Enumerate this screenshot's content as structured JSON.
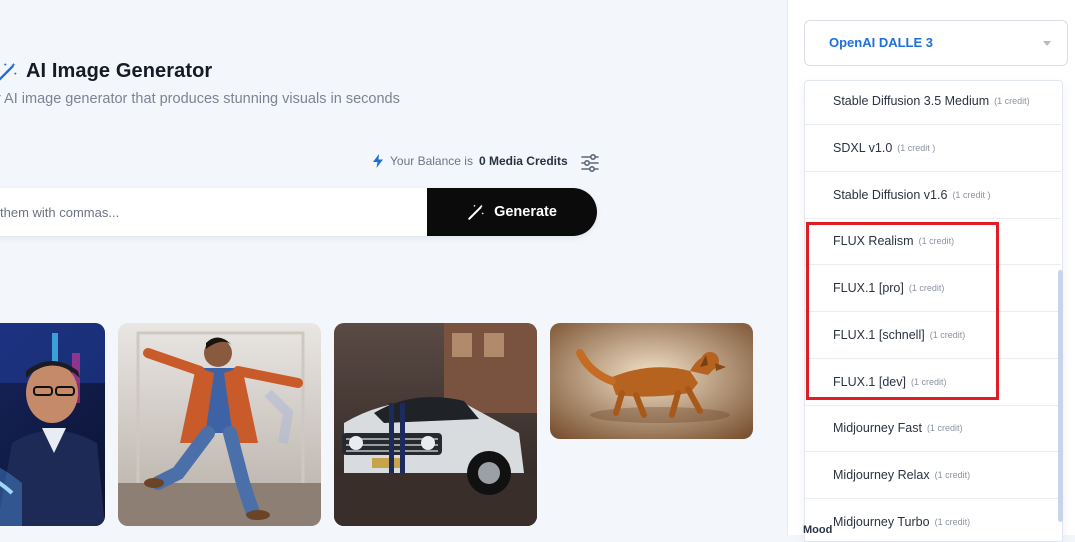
{
  "header": {
    "title": "AI Image Generator",
    "subtitle": "r AI image generator that produces stunning visuals in seconds"
  },
  "balance": {
    "prefix": "Your Balance is",
    "amount": "0 Media Credits"
  },
  "prompt": {
    "placeholder": "them with commas...",
    "value": "",
    "generate_label": "Generate"
  },
  "gallery": [
    {
      "subject": "man in suit driving car at night"
    },
    {
      "subject": "dancer in colorful jacket"
    },
    {
      "subject": "vintage white muscle car"
    },
    {
      "subject": "golden retriever walking"
    }
  ],
  "sidebar": {
    "model_selected": "OpenAI DALLE 3",
    "options": [
      {
        "name": "Stable Diffusion 3.5 Medium",
        "credit": "(1 credit)"
      },
      {
        "name": "SDXL v1.0",
        "credit": "(1 credit )"
      },
      {
        "name": "Stable Diffusion v1.6",
        "credit": "(1 credit )"
      },
      {
        "name": "FLUX Realism",
        "credit": "(1 credit)"
      },
      {
        "name": "FLUX.1 [pro]",
        "credit": "(1 credit)"
      },
      {
        "name": "FLUX.1 [schnell]",
        "credit": "(1 credit)"
      },
      {
        "name": "FLUX.1 [dev]",
        "credit": "(1 credit)"
      },
      {
        "name": "Midjourney Fast",
        "credit": "(1 credit)"
      },
      {
        "name": "Midjourney Relax",
        "credit": "(1 credit)"
      },
      {
        "name": "Midjourney Turbo",
        "credit": "(1 credit)"
      }
    ],
    "partial_label": "Mood"
  },
  "colors": {
    "accent": "#1e6fd9",
    "button_bg": "#0b0b0c",
    "highlight": "#e01d24"
  },
  "icons": {
    "title": "magic-wand-icon",
    "balance": "lightning-icon",
    "filter": "sliders-icon",
    "generate": "magic-wand-icon"
  }
}
